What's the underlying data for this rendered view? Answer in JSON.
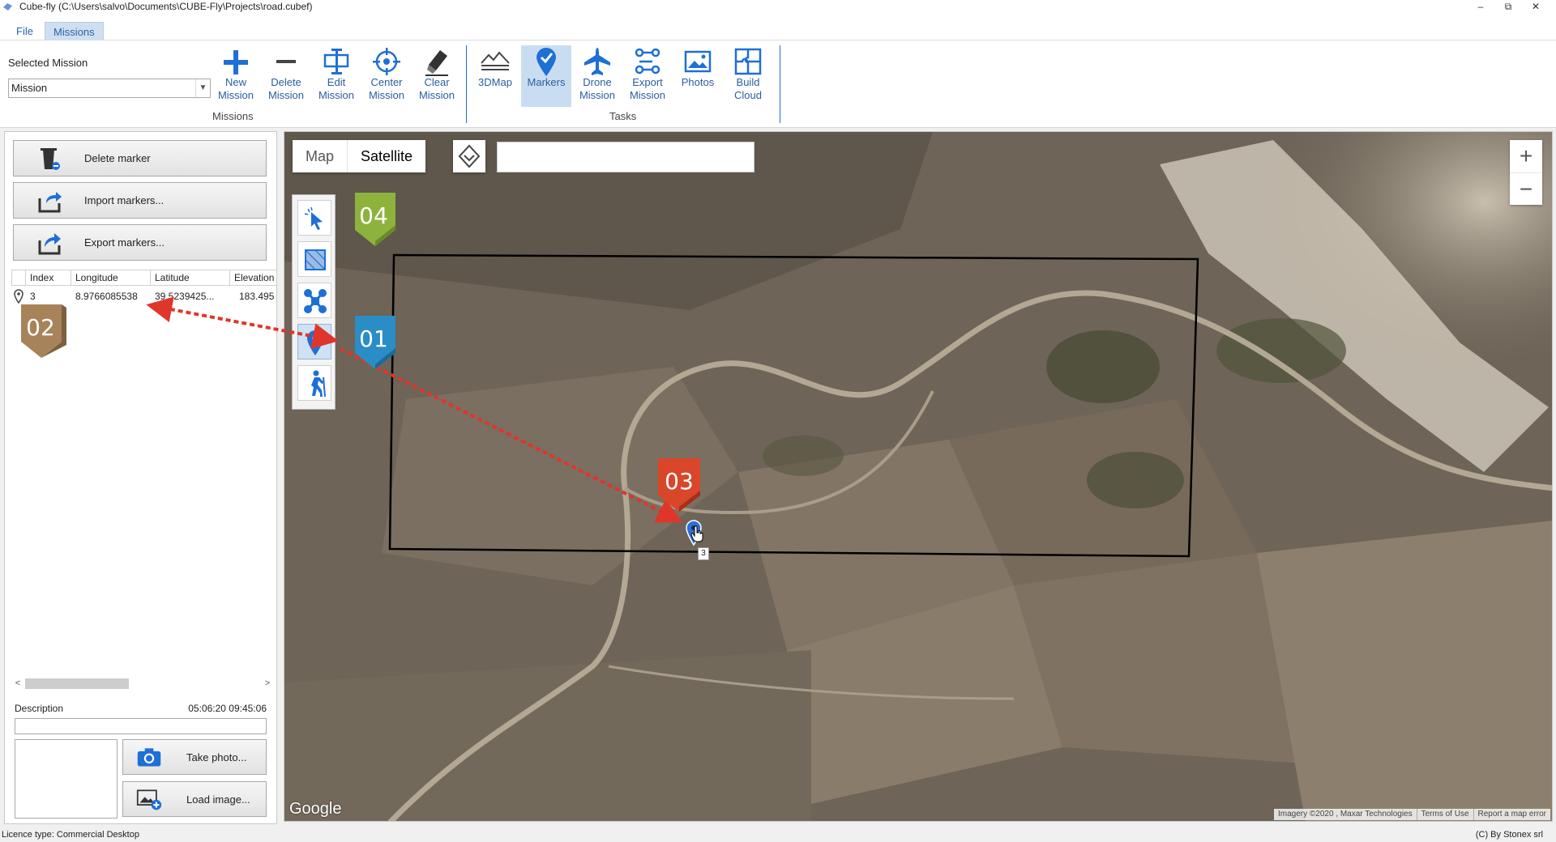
{
  "window": {
    "title": "Cube-fly (C:\\Users\\salvo\\Documents\\CUBE-Fly\\Projects\\road.cubef)",
    "min_glyph": "–",
    "max_glyph": "⧉",
    "close_glyph": "✕"
  },
  "tabs": [
    {
      "label": "File",
      "active": false
    },
    {
      "label": "Missions",
      "active": true
    }
  ],
  "ribbon": {
    "selected_mission_label": "Selected Mission",
    "selected_mission_value": "Mission",
    "buttons": [
      {
        "label": "New\nMission",
        "icon": "plus-icon"
      },
      {
        "label": "Delete\nMission",
        "icon": "minus-icon"
      },
      {
        "label": "Edit\nMission",
        "icon": "edit-icon"
      },
      {
        "label": "Center\nMission",
        "icon": "crosshair-icon"
      },
      {
        "label": "Clear\nMission",
        "icon": "eraser-icon"
      },
      {
        "label": "3DMap",
        "icon": "terrain-icon"
      },
      {
        "label": "Markers",
        "icon": "marker-check-icon",
        "active": true
      },
      {
        "label": "Drone\nMission",
        "icon": "plane-icon"
      },
      {
        "label": "Export\nMission",
        "icon": "export-route-icon"
      },
      {
        "label": "Photos",
        "icon": "photos-icon"
      },
      {
        "label": "Build\nCloud",
        "icon": "puzzle-icon"
      }
    ],
    "groups": {
      "missions": "Missions",
      "tasks": "Tasks"
    }
  },
  "markers_panel": {
    "delete_marker": "Delete marker",
    "import_markers": "Import markers...",
    "export_markers": "Export markers...",
    "columns": [
      "Index",
      "Longitude",
      "Latitude",
      "Elevation"
    ],
    "rows": [
      {
        "index": "3",
        "longitude": "8.9766085538",
        "latitude": "39.5239425...",
        "elevation": "183.495"
      }
    ],
    "description_label": "Description",
    "description_time": "05:06:20 09:45:06",
    "take_photo": "Take photo...",
    "load_image": "Load image..."
  },
  "map": {
    "type_map": "Map",
    "type_satellite": "Satellite",
    "selected_type": "Satellite",
    "search_value": "",
    "zoom_in": "+",
    "zoom_out": "−",
    "google": "Google",
    "attribution": [
      "Imagery ©2020 , Maxar Technologies",
      "Terms of Use",
      "Report a map error"
    ],
    "marker_label": "3"
  },
  "callouts": {
    "badge_01": "01",
    "badge_02": "02",
    "badge_03": "03",
    "badge_04": "04",
    "color_01": "#2a8dc5",
    "color_02": "#a8835a",
    "color_03": "#d9462a",
    "color_04": "#8db33d",
    "arrow_color": "#e0352b"
  },
  "status": {
    "licence": "Licence type: Commercial Desktop",
    "copyright": "(C) By Stonex srl"
  },
  "colors": {
    "accent": "#1e6fd6",
    "ribbon_text": "#2b5e9e"
  }
}
